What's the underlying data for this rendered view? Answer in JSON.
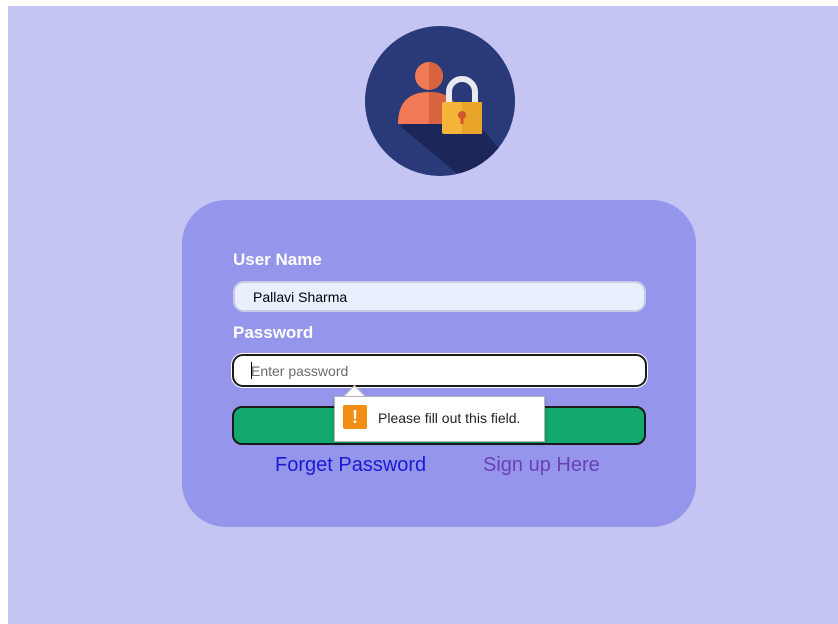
{
  "login_form": {
    "username_label": "User Name",
    "username_value": "Pallavi Sharma",
    "password_label": "Password",
    "password_placeholder": "Enter password",
    "login_button_label": "",
    "forget_password_link": "Forget Password",
    "signup_link": "Sign up Here"
  },
  "validation_tooltip": {
    "icon": "warning-icon",
    "icon_glyph": "!",
    "message": "Please fill out this field."
  },
  "avatar": {
    "icon": "user-lock-icon"
  },
  "colors": {
    "page_background": "#c5c5f3",
    "card_background": "#9595ec",
    "avatar_background": "#2a3a78",
    "button_green": "#13a86d",
    "link_blue": "#1a1ad4",
    "link_purple": "#6b3fb5",
    "warning_orange": "#f28e14"
  }
}
